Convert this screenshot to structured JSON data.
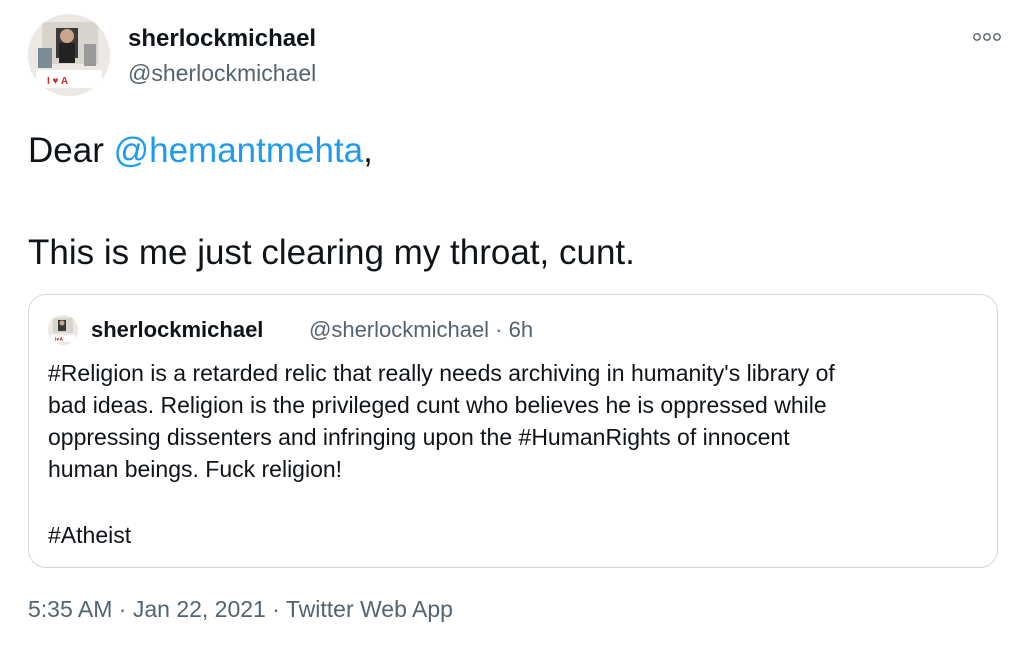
{
  "author": {
    "display_name": "sherlockmichael",
    "handle": "@sherlockmichael",
    "avatar_icon": "profile-photo"
  },
  "more_icon": "more-options-icon",
  "tweet": {
    "greeting_prefix": "Dear ",
    "mention": "@hemantmehta",
    "greeting_suffix": ",",
    "line2": "This is me just clearing my throat, cunt."
  },
  "quoted_tweet": {
    "display_name": "sherlockmichael",
    "meta": "@sherlockmichael · 6h",
    "lines": [
      "#Religion is a retarded relic that really needs archiving in humanity's library of",
      "bad ideas. Religion is the privileged cunt who believes he is oppressed while",
      "oppressing dissenters and infringing upon the #HumanRights of innocent",
      "human beings. Fuck religion!"
    ],
    "hashtag_line": "#Atheist"
  },
  "footer": {
    "time": "5:35 AM",
    "sep1": " · ",
    "date": "Jan 22, 2021",
    "sep2": " · ",
    "source": "Twitter Web App"
  },
  "colors": {
    "link": "#1d9bf0",
    "secondary_text": "#536471",
    "border": "#cfd9de"
  }
}
